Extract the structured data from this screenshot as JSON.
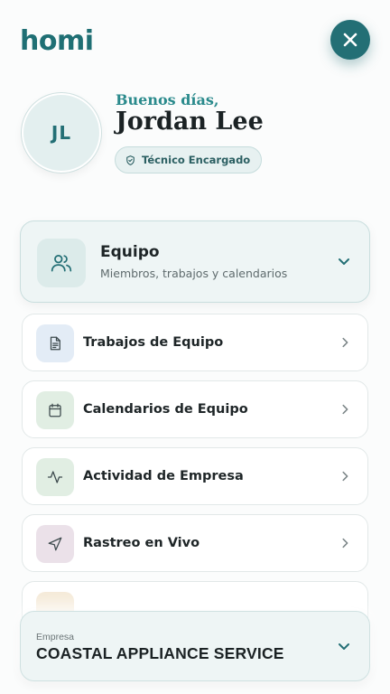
{
  "app": {
    "logo": "homi"
  },
  "header": {
    "close_icon": "close-icon"
  },
  "profile": {
    "initials": "JL",
    "greeting": "Buenos días,",
    "name": "Jordan Lee",
    "role": "Técnico Encargado"
  },
  "team": {
    "title": "Equipo",
    "subtitle": "Miembros, trabajos y calendarios",
    "icon": "users-icon"
  },
  "menu": [
    {
      "label": "Trabajos de Equipo",
      "icon": "document-icon",
      "color": "#e3ecf6"
    },
    {
      "label": "Calendarios de Equipo",
      "icon": "calendar-icon",
      "color": "#e1eee3"
    },
    {
      "label": "Actividad de Empresa",
      "icon": "activity-icon",
      "color": "#e1eee3"
    },
    {
      "label": "Rastreo en Vivo",
      "icon": "navigation-icon",
      "color": "#ebe1e9"
    },
    {
      "label": "",
      "icon": "partial-icon",
      "color": "#f5ead8"
    }
  ],
  "company": {
    "label": "Empresa",
    "name": "COASTAL APPLIANCE SERVICE"
  },
  "colors": {
    "brand": "#236f75",
    "accent": "#2a8a8c",
    "card_bg": "#eef5f5"
  }
}
